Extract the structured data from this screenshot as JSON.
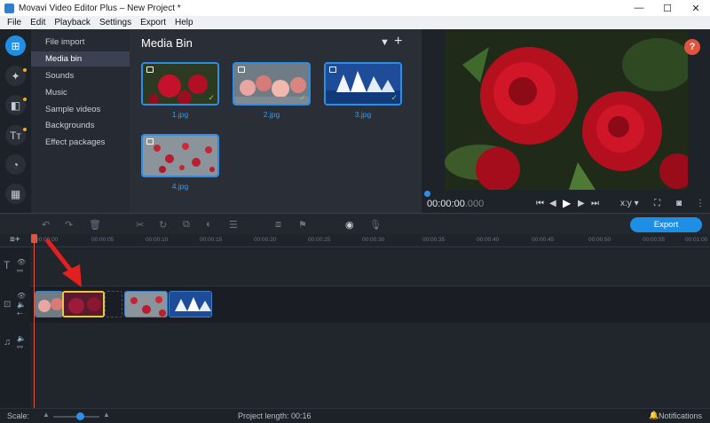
{
  "window": {
    "title": "Movavi Video Editor Plus – New Project *",
    "minimize": "—",
    "maximize": "☐",
    "close": "✕"
  },
  "menu": [
    "File",
    "Edit",
    "Playback",
    "Settings",
    "Export",
    "Help"
  ],
  "left_tools": [
    {
      "name": "import-icon",
      "glyph": "⊞"
    },
    {
      "name": "magic-wand-icon",
      "glyph": "✦"
    },
    {
      "name": "transitions-icon",
      "glyph": "◧"
    },
    {
      "name": "titles-icon",
      "glyph": "Tт"
    },
    {
      "name": "stickers-icon",
      "glyph": "◔"
    },
    {
      "name": "more-tools-icon",
      "glyph": "▦"
    }
  ],
  "categories": [
    "File import",
    "Media bin",
    "Sounds",
    "Music",
    "Sample videos",
    "Backgrounds",
    "Effect packages"
  ],
  "selected_category": "Media bin",
  "media_bin": {
    "title": "Media Bin",
    "filter_icon": "▼",
    "add_icon": "+",
    "items": [
      {
        "label": "1.jpg",
        "checked": true
      },
      {
        "label": "2.jpg",
        "checked": true
      },
      {
        "label": "3.jpg",
        "checked": true
      },
      {
        "label": "4.jpg",
        "checked": false
      }
    ]
  },
  "preview": {
    "help": "?",
    "time": "00:00:00",
    "time_ms": ".000",
    "aspect": "x:y",
    "aspect_arrow": "▾"
  },
  "toolbar": {
    "export_label": "Export"
  },
  "ruler_ticks": [
    "00:00:00",
    "00:00:05",
    "00:00:10",
    "00:00:15",
    "00:00:20",
    "00:00:25",
    "00:00:30",
    "00:00:35",
    "00:00:40",
    "00:00:45",
    "00:00:50",
    "00:00:55",
    "00:01:00"
  ],
  "status": {
    "scale_label": "Scale:",
    "project_length": "Project length:  00:16",
    "notifications": "Notifications"
  },
  "colors": {
    "accent": "#1f8fe6",
    "help_badge": "#e0533f",
    "arrow": "#e32020",
    "selection": "#e8c842"
  }
}
